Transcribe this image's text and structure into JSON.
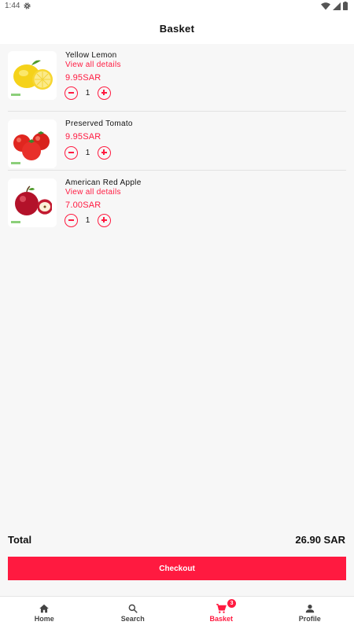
{
  "status_bar": {
    "time": "1:44"
  },
  "header": {
    "title": "Basket"
  },
  "items": [
    {
      "name": "Yellow Lemon",
      "details_link": "View all details",
      "price": "9.95SAR",
      "quantity": "1"
    },
    {
      "name": "Preserved Tomato",
      "details_link": "",
      "price": "9.95SAR",
      "quantity": "1"
    },
    {
      "name": "American Red Apple",
      "details_link": "View all details",
      "price": "7.00SAR",
      "quantity": "1"
    }
  ],
  "summary": {
    "total_label": "Total",
    "total_value": "26.90 SAR"
  },
  "checkout": {
    "label": "Checkout"
  },
  "nav": {
    "items": [
      {
        "label": "Home",
        "icon": "home-icon"
      },
      {
        "label": "Search",
        "icon": "search-icon"
      },
      {
        "label": "Basket",
        "icon": "cart-icon",
        "badge": "3",
        "active": true
      },
      {
        "label": "Profile",
        "icon": "person-icon"
      }
    ]
  },
  "colors": {
    "accent": "#ff1a40",
    "background": "#f7f7f7"
  }
}
